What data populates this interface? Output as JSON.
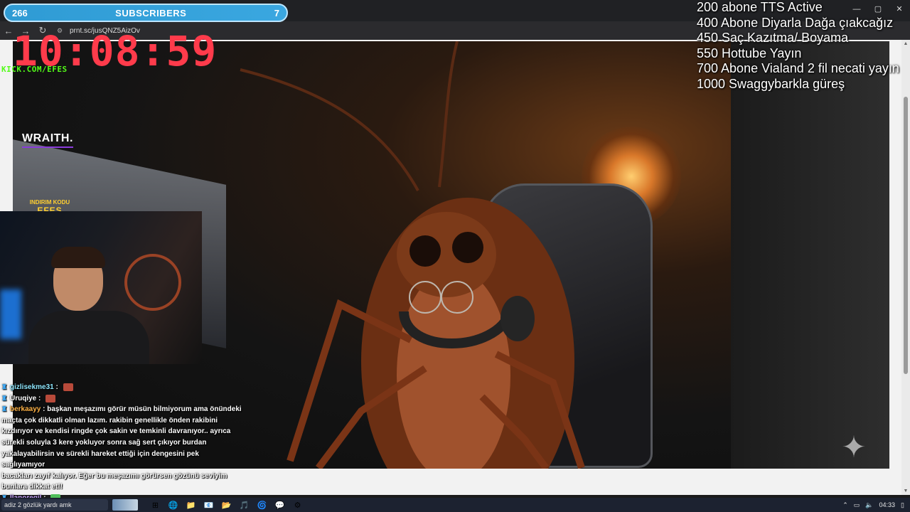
{
  "browser": {
    "url": "prnt.sc/jusQNZ5AizOv",
    "back_icon": "arrow-left-icon",
    "forward_icon": "arrow-right-icon",
    "reload_icon": "reload-icon",
    "window_controls": [
      "—",
      "▢",
      "✕"
    ]
  },
  "subs_bar": {
    "current": "266",
    "label": "SUBSCRIBERS",
    "goal_count": "7",
    "progress_fraction": 0.0,
    "color": "#3aa7e0"
  },
  "clock": "10:08:59",
  "kick_link": "KICK.COM/EFES",
  "sponsor": {
    "brand": "WRAITH.",
    "discount_label": "INDIRIM KODU",
    "discount_code": "EFES"
  },
  "goals": [
    "200 abone TTS Active",
    "400 Abone Diyarla Dağa çıakcağız",
    "450 Saç Kazıtma/ Boyama",
    "550 Hottube Yayın",
    "700 Abone Vialand 2 fil necati yayın",
    "1000 Swaggybarkla güreş"
  ],
  "chat": [
    {
      "user": "gizlisekme31",
      "user_color": "#8fe8ff",
      "text": "",
      "emote": "red"
    },
    {
      "user": "Uruqiye",
      "user_color": "#ffffff",
      "text": "",
      "emote": "red"
    },
    {
      "user": "berkaayy",
      "user_color": "#ffb347",
      "text": "başkan meşazımı görür müsün bilmiyorum ama önündeki",
      "emote": ""
    },
    {
      "user": "",
      "user_color": "#ffffff",
      "text": "maçta çok dikkatli olman lazım. rakibin genellikle önden rakibini",
      "emote": ""
    },
    {
      "user": "",
      "user_color": "#ffffff",
      "text": "kızdırıyor ve kendisi ringde çok sakin ve temkinli davranıyor.. ayrıca",
      "emote": ""
    },
    {
      "user": "",
      "user_color": "#ffffff",
      "text": "sürekli soluyla 3 kere yokluyor sonra sağ sert çıkıyor burdan",
      "emote": ""
    },
    {
      "user": "",
      "user_color": "#ffffff",
      "text": "yakalayabilirsin ve sürekli hareket ettiği için dengesini pek sağlıyamıyor",
      "emote": ""
    },
    {
      "user": "",
      "user_color": "#ffffff",
      "text": "bacakları zayıf kalıyor. Eğer bu meşazımı görürsen gözünü seviyim",
      "emote": ""
    },
    {
      "user": "",
      "user_color": "#ffffff",
      "text": "bunlara dikkat et!!",
      "emote": ""
    },
    {
      "user": "llanoregil",
      "user_color": "#c9a6ff",
      "text": "",
      "emote": "green"
    }
  ],
  "taskbar": {
    "search_text": "adiz 2 gözlük yardı amk",
    "apps": [
      "⊞",
      "🌐",
      "📁",
      "📧",
      "📂",
      "🎵",
      "🌀",
      "💬",
      "⚙"
    ],
    "app_icons": [
      "edge-icon",
      "photos-icon",
      "store-icon",
      "mail-icon",
      "explorer-icon",
      "spotify-icon",
      "chrome-icon",
      "discord-icon",
      "settings-icon"
    ],
    "time": "04:33"
  }
}
